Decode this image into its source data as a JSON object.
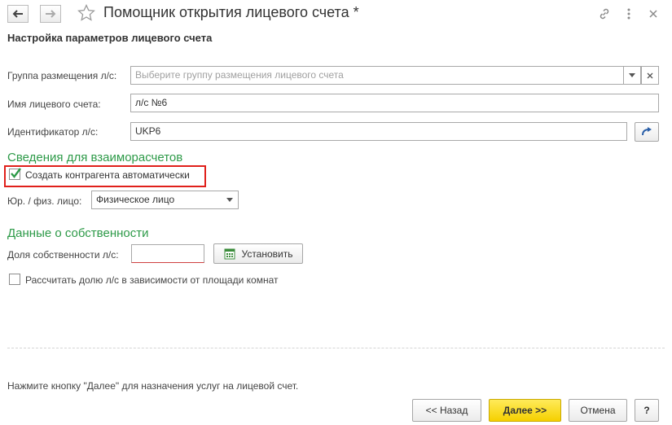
{
  "window": {
    "title": "Помощник открытия лицевого счета *",
    "section_title": "Настройка параметров лицевого счета"
  },
  "form": {
    "group": {
      "label": "Группа размещения л/с:",
      "placeholder": "Выберите группу размещения лицевого счета",
      "value": ""
    },
    "account_name": {
      "label": "Имя лицевого счета:",
      "value": "л/с №6"
    },
    "identifier": {
      "label": "Идентификатор л/с:",
      "value": "UKP6"
    }
  },
  "settlements": {
    "heading": "Сведения для взаиморасчетов",
    "auto_create": {
      "label": "Создать контрагента автоматически",
      "checked": true
    },
    "entity_type": {
      "label": "Юр. / физ. лицо:",
      "value": "Физическое лицо"
    }
  },
  "ownership": {
    "heading": "Данные о собственности",
    "share": {
      "label": "Доля собственности л/с:",
      "value": ""
    },
    "set_button": "Установить",
    "calc_by_area": {
      "label": "Рассчитать долю л/с в зависимости от площади комнат",
      "checked": false
    }
  },
  "footer": {
    "hint": "Нажмите кнопку \"Далее\" для назначения услуг на лицевой счет.",
    "back": "<< Назад",
    "next": "Далее >>",
    "cancel": "Отмена",
    "help": "?"
  },
  "colors": {
    "accent_green": "#2d9a48",
    "highlight_red": "#e0201b",
    "primary_yellow": "#f5d000"
  }
}
